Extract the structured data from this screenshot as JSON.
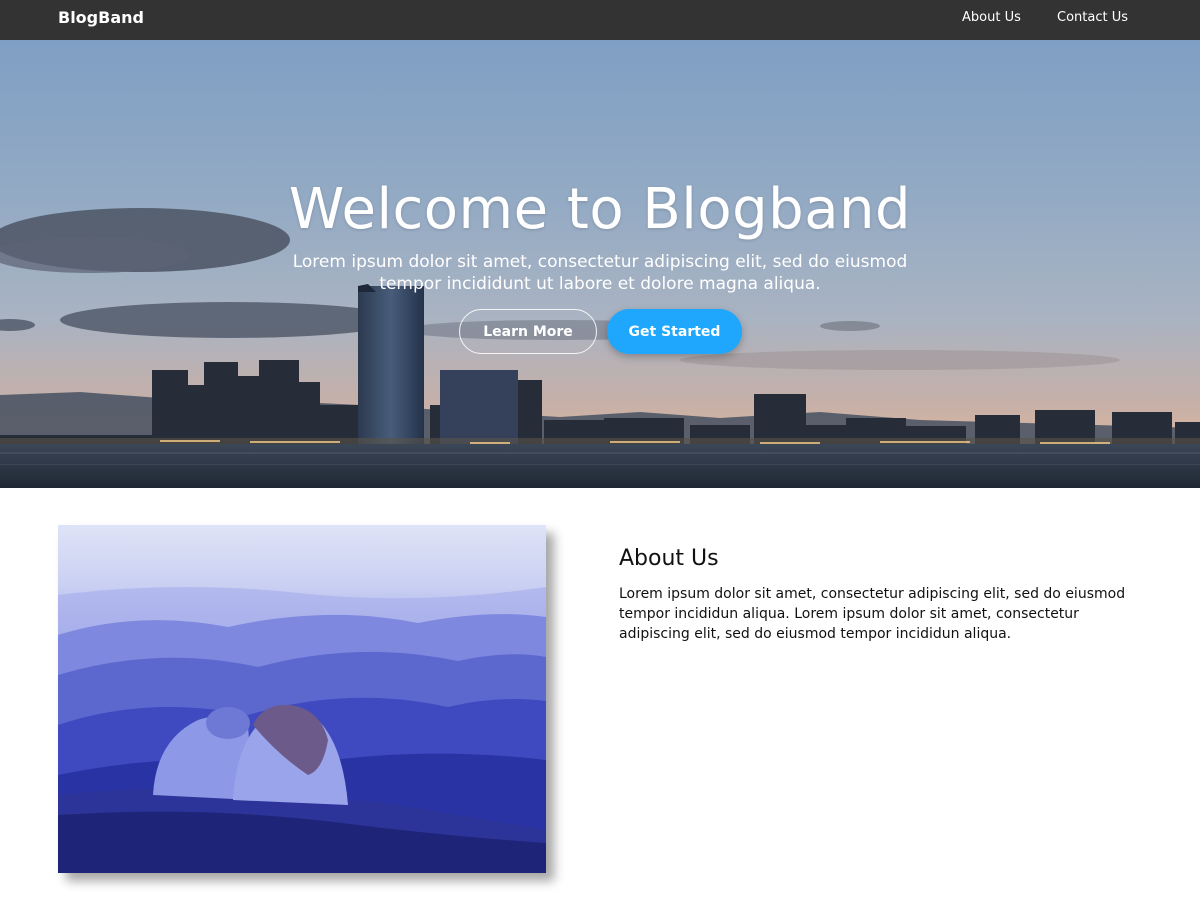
{
  "navbar": {
    "brand": "BlogBand",
    "links": [
      {
        "label": "About Us"
      },
      {
        "label": "Contact Us"
      }
    ]
  },
  "hero": {
    "title": "Welcome to Blogband",
    "subtitle": "Lorem ipsum dolor sit amet, consectetur adipiscing elit, sed do eiusmod tempor incididunt ut labore et dolore magna aliqua.",
    "buttons": {
      "learn_more": "Learn More",
      "get_started": "Get Started"
    }
  },
  "about": {
    "heading": "About Us",
    "text": "Lorem ipsum dolor sit amet, consectetur adipiscing elit, sed do eiusmod tempor incididun aliqua. Lorem ipsum dolor sit amet, consectetur adipiscing elit, sed do eiusmod tempor incididun aliqua."
  },
  "colors": {
    "navbar_bg": "#333333",
    "accent": "#1ea7fd",
    "text_dark": "#111111"
  }
}
